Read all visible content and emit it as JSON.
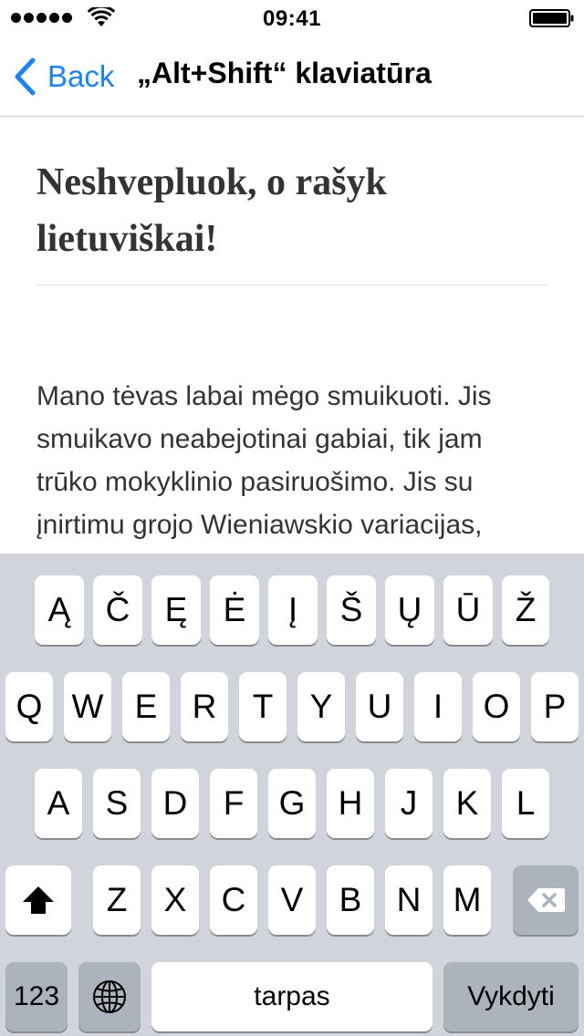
{
  "status_bar": {
    "time": "09:41"
  },
  "nav": {
    "back_label": "Back",
    "title": "„Alt+Shift“ klaviatūra"
  },
  "article": {
    "title": "Neshvepluok, o rašyk lietuviškai!",
    "body": "Mano tėvas labai mėgo smuikuoti. Jis smuikavo neabejotinai gabiai, tik jam trūko mokyklinio pasiruošimo. Jis su įnirtimu grojo Wieniawskio variacijas,"
  },
  "keyboard": {
    "rows": [
      [
        "Ą",
        "Č",
        "Ę",
        "Ė",
        "Į",
        "Š",
        "Ų",
        "Ū",
        "Ž"
      ],
      [
        "Q",
        "W",
        "E",
        "R",
        "T",
        "Y",
        "U",
        "I",
        "O",
        "P"
      ],
      [
        "A",
        "S",
        "D",
        "F",
        "G",
        "H",
        "J",
        "K",
        "L"
      ],
      [
        "Z",
        "X",
        "C",
        "V",
        "B",
        "N",
        "M"
      ]
    ],
    "numbers_label": "123",
    "space_label": "tarpas",
    "return_label": "Vykdyti",
    "icons": {
      "shift": "shift-icon",
      "backspace": "backspace-icon",
      "globe": "globe-icon"
    }
  }
}
